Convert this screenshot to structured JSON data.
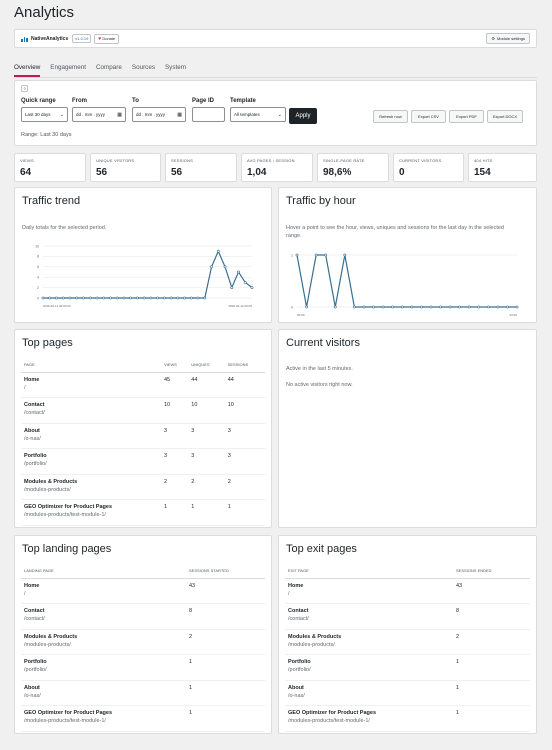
{
  "page": {
    "title": "Analytics"
  },
  "header": {
    "brand": "NativeAnalytics",
    "version": "v1.0.19",
    "donate_label": "Donate",
    "module_settings_label": "Module settings"
  },
  "tabs": [
    {
      "label": "Overview",
      "active": true
    },
    {
      "label": "Engagement",
      "active": false
    },
    {
      "label": "Compare",
      "active": false
    },
    {
      "label": "Sources",
      "active": false
    },
    {
      "label": "System",
      "active": false
    }
  ],
  "filters": {
    "help_label": "?",
    "quick_range": {
      "label": "Quick range",
      "value": "Last 30 days"
    },
    "from": {
      "label": "From",
      "value": "dd . mm . yyyy"
    },
    "to": {
      "label": "To",
      "value": "dd . mm . yyyy"
    },
    "page_id": {
      "label": "Page ID",
      "value": ""
    },
    "template": {
      "label": "Template",
      "value": "All templates"
    },
    "apply_label": "Apply",
    "buttons": [
      "Refresh now",
      "Export CSV",
      "Export PDF",
      "Export DOCX"
    ],
    "range_text": "Range: Last 30 days"
  },
  "kpis": [
    {
      "label": "Views",
      "value": "64"
    },
    {
      "label": "Unique visitors",
      "value": "56"
    },
    {
      "label": "Sessions",
      "value": "56"
    },
    {
      "label": "Avg pages / session",
      "value": "1,04"
    },
    {
      "label": "Single-page rate",
      "value": "98,6%"
    },
    {
      "label": "Current visitors",
      "value": "0"
    },
    {
      "label": "404 hits",
      "value": "154"
    }
  ],
  "traffic_trend": {
    "title": "Traffic trend",
    "subtitle": "Daily totals for the selected period."
  },
  "traffic_hour": {
    "title": "Traffic by hour",
    "subtitle": "Hover a point to see the hour, views, uniques and sessions for the last day in the selected range."
  },
  "top_pages": {
    "title": "Top pages",
    "columns": [
      "Page",
      "Views",
      "Uniques",
      "Sessions"
    ],
    "rows": [
      {
        "title": "Home",
        "path": "/",
        "views": "45",
        "uniques": "44",
        "sessions": "44"
      },
      {
        "title": "Contact",
        "path": "/contact/",
        "views": "10",
        "uniques": "10",
        "sessions": "10"
      },
      {
        "title": "About",
        "path": "/o-nas/",
        "views": "3",
        "uniques": "3",
        "sessions": "3"
      },
      {
        "title": "Portfolio",
        "path": "/portfolio/",
        "views": "3",
        "uniques": "3",
        "sessions": "3"
      },
      {
        "title": "Modules & Products",
        "path": "/modules-products/",
        "views": "2",
        "uniques": "2",
        "sessions": "2"
      },
      {
        "title": "GEO Optimizer for Product Pages",
        "path": "/modules-products/test-module-1/",
        "views": "1",
        "uniques": "1",
        "sessions": "1"
      }
    ]
  },
  "current_visitors": {
    "title": "Current visitors",
    "line1": "Active in the last 5 minutes.",
    "line2": "No active visitors right now."
  },
  "top_landing": {
    "title": "Top landing pages",
    "columns": [
      "Landing page",
      "Sessions started"
    ],
    "rows": [
      {
        "title": "Home",
        "path": "/",
        "value": "43"
      },
      {
        "title": "Contact",
        "path": "/contact/",
        "value": "8"
      },
      {
        "title": "Modules & Products",
        "path": "/modules-products/",
        "value": "2"
      },
      {
        "title": "Portfolio",
        "path": "/portfolio/",
        "value": "1"
      },
      {
        "title": "About",
        "path": "/o-nas/",
        "value": "1"
      },
      {
        "title": "GEO Optimizer for Product Pages",
        "path": "/modules-products/test-module-1/",
        "value": "1"
      }
    ]
  },
  "top_exit": {
    "title": "Top exit pages",
    "columns": [
      "Exit page",
      "Sessions ended"
    ],
    "rows": [
      {
        "title": "Home",
        "path": "/",
        "value": "43"
      },
      {
        "title": "Contact",
        "path": "/contact/",
        "value": "8"
      },
      {
        "title": "Modules & Products",
        "path": "/modules-products/",
        "value": "2"
      },
      {
        "title": "Portfolio",
        "path": "/portfolio/",
        "value": "1"
      },
      {
        "title": "About",
        "path": "/o-nas/",
        "value": "1"
      },
      {
        "title": "GEO Optimizer for Product Pages",
        "path": "/modules-products/test-module-1/",
        "value": "1"
      }
    ]
  },
  "colors": {
    "accent": "#c2185b",
    "line": "#3b6e8f",
    "grid": "#e5e5e5"
  },
  "chart_data": [
    {
      "type": "line",
      "ylim": [
        0,
        10
      ],
      "yticks": [
        "0",
        "2",
        "4",
        "6",
        "8",
        "10"
      ],
      "xtick_first": "2026-02-11 00:00:00",
      "xtick_last": "2026-02-12 00:00",
      "values": [
        0,
        0,
        0,
        0,
        0,
        0,
        0,
        0,
        0,
        0,
        0,
        0,
        0,
        0,
        0,
        0,
        0,
        0,
        0,
        0,
        0,
        0,
        0,
        0,
        0,
        6,
        9,
        6,
        2,
        5,
        3,
        2
      ]
    },
    {
      "type": "line",
      "ylim": [
        0,
        1
      ],
      "yticks": [
        "0",
        "1"
      ],
      "xtick_first": "00:00",
      "xtick_last": "23:00",
      "values": [
        1,
        0,
        1,
        1,
        0,
        1,
        0,
        0,
        0,
        0,
        0,
        0,
        0,
        0,
        0,
        0,
        0,
        0,
        0,
        0,
        0,
        0,
        0,
        0
      ]
    }
  ]
}
